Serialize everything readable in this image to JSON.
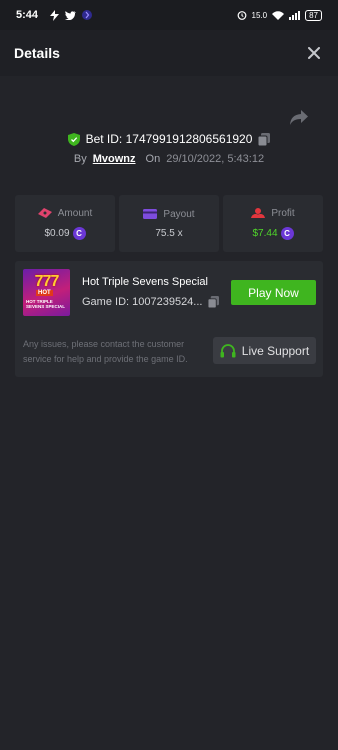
{
  "status_bar": {
    "time": "5:44",
    "net_speed": "15.0",
    "battery": "87"
  },
  "header": {
    "title": "Details"
  },
  "bet": {
    "bet_id_text": "Bet ID: 1747991912806561920",
    "by_label": "By",
    "username": "Mvownz",
    "on_label": "On",
    "datetime": "29/10/2022, 5:43:12"
  },
  "stats": [
    {
      "label": "Amount",
      "value": "$0.09",
      "icon": "money-icon",
      "has_coin": true
    },
    {
      "label": "Payout",
      "value": "75.5 x",
      "icon": "card-icon",
      "has_coin": false
    },
    {
      "label": "Profit",
      "value": "$7.44",
      "icon": "profit-icon",
      "has_coin": true
    }
  ],
  "game": {
    "name": "Hot Triple Sevens Special",
    "id_text": "Game ID: 1007239524...",
    "thumb_text_top": "777",
    "thumb_text_hot": "HOT",
    "thumb_text_name": "HOT TRIPLE SEVENS SPECIAL",
    "play_label": "Play Now",
    "notice": "Any issues, please contact the customer service for help and provide the game ID.",
    "support_label": "Live Support"
  },
  "colors": {
    "background": "#232429",
    "card": "#2a2c31",
    "accent_green": "#3fb51f",
    "profit_green": "#4fd62a",
    "coin_purple": "#6b37d6",
    "amount_pink": "#e0436d",
    "payout_purple": "#7e4cdc",
    "profit_red": "#e2363d"
  }
}
